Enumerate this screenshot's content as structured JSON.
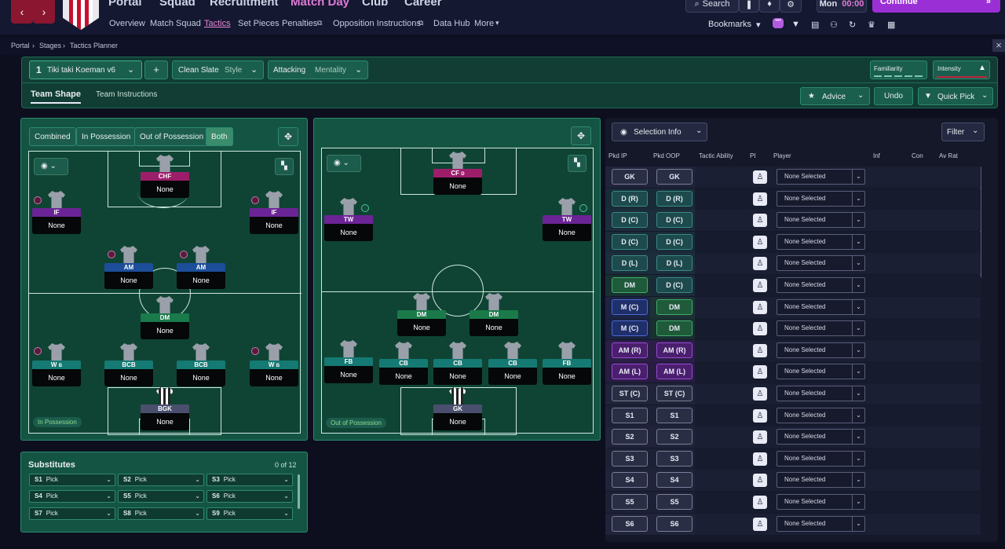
{
  "topbar": {
    "menus": [
      "Portal",
      "Squad",
      "Recruitment",
      "Match Day",
      "Club",
      "Career"
    ],
    "subnav": [
      "Overview",
      "Match Squad",
      "Tactics",
      "Set Pieces",
      "Penalties",
      "Opposition Instructions",
      "Data Hub",
      "More"
    ],
    "search": "Search",
    "day": "Mon",
    "time": "00:00",
    "continue": "Continue",
    "bookmarks": "Bookmarks"
  },
  "breadcrumb": {
    "portal": "Portal",
    "stages": "Stages",
    "page": "Tactics Planner"
  },
  "toolbar": {
    "tactic_num": "1",
    "tactic_name": "Tiki taki Koeman v6",
    "add": "+",
    "style_value": "Clean Slate",
    "style_label": "Style",
    "mentality_value": "Attacking",
    "mentality_label": "Mentality",
    "familiarity": "Familiarity",
    "intensity": "Intensity",
    "tab_shape": "Team Shape",
    "tab_instructions": "Team Instructions",
    "advice": "Advice",
    "undo": "Undo",
    "quick_pick": "Quick Pick"
  },
  "ip_panel": {
    "tabs": [
      "Combined",
      "In Possession",
      "Out of Possession",
      "Both"
    ],
    "label": "In Possession",
    "players": [
      {
        "role": "CHF",
        "name": "None"
      },
      {
        "role": "IF",
        "name": "None"
      },
      {
        "role": "IF",
        "name": "None"
      },
      {
        "role": "AM",
        "name": "None"
      },
      {
        "role": "AM",
        "name": "None"
      },
      {
        "role": "DM",
        "name": "None"
      },
      {
        "role": "W",
        "sub": "B",
        "name": "None"
      },
      {
        "role": "BCB",
        "name": "None"
      },
      {
        "role": "BCB",
        "name": "None"
      },
      {
        "role": "W",
        "sub": "B",
        "name": "None"
      },
      {
        "role": "BGK",
        "name": "None"
      }
    ]
  },
  "oop_panel": {
    "label": "Out of Possession",
    "players": [
      {
        "role": "CF",
        "sub": "D",
        "name": "None"
      },
      {
        "role": "TW",
        "name": "None"
      },
      {
        "role": "TW",
        "name": "None"
      },
      {
        "role": "DM",
        "name": "None"
      },
      {
        "role": "DM",
        "name": "None"
      },
      {
        "role": "FB",
        "name": "None"
      },
      {
        "role": "CB",
        "name": "None"
      },
      {
        "role": "CB",
        "name": "None"
      },
      {
        "role": "CB",
        "name": "None"
      },
      {
        "role": "FB",
        "name": "None"
      },
      {
        "role": "GK",
        "name": "None"
      }
    ]
  },
  "substitutes": {
    "title": "Substitutes",
    "count": "0 of 12",
    "slots": [
      {
        "slot": "S1",
        "value": "Pick"
      },
      {
        "slot": "S2",
        "value": "Pick"
      },
      {
        "slot": "S3",
        "value": "Pick"
      },
      {
        "slot": "S4",
        "value": "Pick"
      },
      {
        "slot": "S5",
        "value": "Pick"
      },
      {
        "slot": "S6",
        "value": "Pick"
      },
      {
        "slot": "S7",
        "value": "Pick"
      },
      {
        "slot": "S8",
        "value": "Pick"
      },
      {
        "slot": "S9",
        "value": "Pick"
      }
    ]
  },
  "selection": {
    "title": "Selection Info",
    "filter": "Filter",
    "headers": [
      "Pkd IP",
      "Pkd OOP",
      "Tactic Ability",
      "PI",
      "Player",
      "Inf",
      "Con",
      "Av Rat"
    ],
    "rows": [
      {
        "ip": "GK",
        "oop": "GK",
        "player": "None Selected"
      },
      {
        "ip": "D (R)",
        "oop": "D (R)",
        "player": "None Selected"
      },
      {
        "ip": "D (C)",
        "oop": "D (C)",
        "player": "None Selected"
      },
      {
        "ip": "D (C)",
        "oop": "D (C)",
        "player": "None Selected"
      },
      {
        "ip": "D (L)",
        "oop": "D (L)",
        "player": "None Selected"
      },
      {
        "ip": "DM",
        "oop": "D (C)",
        "player": "None Selected"
      },
      {
        "ip": "M (C)",
        "oop": "DM",
        "player": "None Selected"
      },
      {
        "ip": "M (C)",
        "oop": "DM",
        "player": "None Selected"
      },
      {
        "ip": "AM (R)",
        "oop": "AM (R)",
        "player": "None Selected"
      },
      {
        "ip": "AM (L)",
        "oop": "AM (L)",
        "player": "None Selected"
      },
      {
        "ip": "ST (C)",
        "oop": "ST (C)",
        "player": "None Selected"
      },
      {
        "ip": "S1",
        "oop": "S1",
        "player": "None Selected"
      },
      {
        "ip": "S2",
        "oop": "S2",
        "player": "None Selected"
      },
      {
        "ip": "S3",
        "oop": "S3",
        "player": "None Selected"
      },
      {
        "ip": "S4",
        "oop": "S4",
        "player": "None Selected"
      },
      {
        "ip": "S5",
        "oop": "S5",
        "player": "None Selected"
      },
      {
        "ip": "S6",
        "oop": "S6",
        "player": "None Selected"
      }
    ]
  },
  "colors": {
    "accent": "#9a2fd6",
    "pitch": "#0f4434",
    "panel": "#113d34"
  }
}
